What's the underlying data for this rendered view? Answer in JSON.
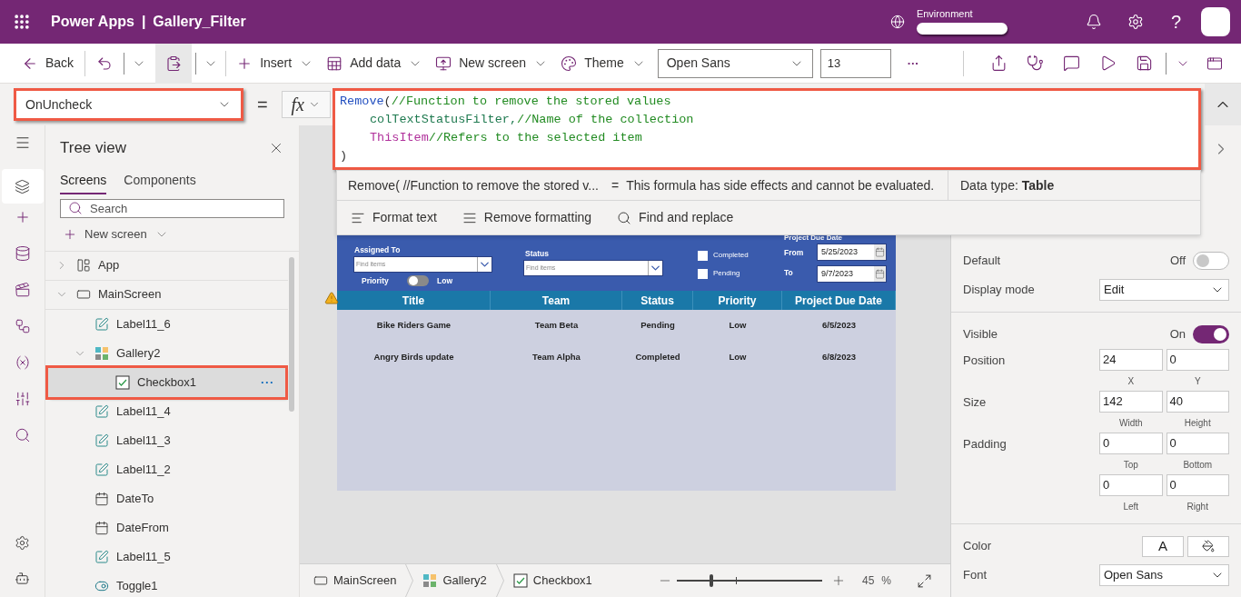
{
  "app_bar": {
    "product": "Power Apps",
    "separator": "|",
    "app_name": "Gallery_Filter",
    "environment_label": "Environment",
    "help_glyph": "?"
  },
  "toolbar": {
    "back": "Back",
    "paste_active": true,
    "commands": [
      {
        "label": "Insert",
        "kind": "insert"
      },
      {
        "label": "Add data",
        "kind": "add_data"
      },
      {
        "label": "New screen",
        "kind": "new_screen"
      },
      {
        "label": "Theme",
        "kind": "theme"
      }
    ],
    "font": "Open Sans",
    "font_size": "13",
    "more": "···"
  },
  "formula_bar": {
    "property": "OnUncheck",
    "property_highlighted": true,
    "equals": "=",
    "fx": "fx",
    "editor_highlighted": true,
    "code_lines": [
      {
        "indented": false,
        "tokens": [
          {
            "kind": "function",
            "text": "Remove"
          },
          {
            "kind": "punctuation",
            "text": "("
          },
          {
            "kind": "comment",
            "text": "//Function to remove the stored values"
          }
        ]
      },
      {
        "indented": true,
        "tokens": [
          {
            "kind": "collection",
            "text": "colTextStatusFilter,"
          },
          {
            "kind": "comment",
            "text": "//Name of the collection"
          }
        ]
      },
      {
        "indented": true,
        "tokens": [
          {
            "kind": "keyword",
            "text": "ThisItem"
          },
          {
            "kind": "comment",
            "text": "//Refers to the selected item"
          }
        ]
      },
      {
        "indented": false,
        "tokens": [
          {
            "kind": "punctuation",
            "text": ")"
          }
        ]
      }
    ],
    "result": {
      "expression": "Remove( //Function to remove the stored v...",
      "equals": "=",
      "message": "This formula has side effects and cannot be evaluated.",
      "data_type_label": "Data type:",
      "data_type": "Table"
    },
    "actions": [
      {
        "label": "Format text",
        "kind": "format"
      },
      {
        "label": "Remove formatting",
        "kind": "clear"
      },
      {
        "label": "Find and replace",
        "kind": "find"
      }
    ]
  },
  "tree_view": {
    "title": "Tree view",
    "tabs": [
      {
        "label": "Screens",
        "selected": true
      },
      {
        "label": "Components",
        "selected": false
      }
    ],
    "search_placeholder": "Search",
    "new_screen": "New screen",
    "items": [
      {
        "name": "App",
        "kind": "app",
        "expanded": false,
        "selected": false,
        "highlighted": false
      },
      {
        "name": "MainScreen",
        "kind": "screen",
        "expanded": true,
        "selected": false,
        "highlighted": false,
        "children": [
          {
            "name": "Label11_6",
            "kind": "label",
            "selected": false,
            "highlighted": false
          },
          {
            "name": "Gallery2",
            "kind": "gallery",
            "expanded": true,
            "selected": false,
            "highlighted": false,
            "children": [
              {
                "name": "Checkbox1",
                "kind": "checkbox",
                "selected": true,
                "highlighted": true,
                "more": "···"
              }
            ]
          },
          {
            "name": "Label11_4",
            "kind": "label",
            "selected": false,
            "highlighted": false
          },
          {
            "name": "Label11_3",
            "kind": "label",
            "selected": false,
            "highlighted": false
          },
          {
            "name": "Label11_2",
            "kind": "label",
            "selected": false,
            "highlighted": false
          },
          {
            "name": "DateTo",
            "kind": "date",
            "selected": false,
            "highlighted": false
          },
          {
            "name": "DateFrom",
            "kind": "date",
            "selected": false,
            "highlighted": false
          },
          {
            "name": "Label11_5",
            "kind": "label",
            "selected": false,
            "highlighted": false
          },
          {
            "name": "Toggle1",
            "kind": "toggle",
            "selected": false,
            "highlighted": false
          }
        ]
      }
    ]
  },
  "canvas": {
    "filters": {
      "assigned_to": {
        "label": "Assigned To",
        "placeholder": "Find items"
      },
      "priority": {
        "label": "Priority",
        "on": false,
        "value_label": "Low"
      },
      "status": {
        "label": "Status",
        "placeholder": "Find items"
      },
      "checkboxes": [
        {
          "label": "Completed",
          "checked": false
        },
        {
          "label": "Pending",
          "checked": false
        }
      ],
      "due_date": {
        "title": "Project Due Date",
        "from_label": "From",
        "from": "5/25/2023",
        "to_label": "To",
        "to": "9/7/2023"
      }
    },
    "table": {
      "columns": [
        "Title",
        "Team",
        "Status",
        "Priority",
        "Project Due Date"
      ],
      "rows": [
        [
          "Bike Riders Game",
          "Team Beta",
          "Pending",
          "Low",
          "6/5/2023"
        ],
        [
          "Angry Birds update",
          "Team Alpha",
          "Completed",
          "Low",
          "6/8/2023"
        ]
      ]
    }
  },
  "breadcrumb": [
    {
      "label": "MainScreen",
      "kind": "screen"
    },
    {
      "label": "Gallery2",
      "kind": "gallery"
    },
    {
      "label": "Checkbox1",
      "kind": "checkbox"
    }
  ],
  "zoom": {
    "level": 0.24,
    "value": "45",
    "unit": "%"
  },
  "properties": {
    "sections": [
      {
        "rows": [
          {
            "kind": "toggle",
            "label": "Default",
            "state_text": "Off",
            "on": false
          },
          {
            "kind": "dropdown",
            "label": "Display mode",
            "value": "Edit"
          }
        ]
      },
      {
        "rows": [
          {
            "kind": "toggle",
            "label": "Visible",
            "state_text": "On",
            "on": true
          },
          {
            "kind": "fields",
            "label": "Position",
            "fields": [
              {
                "value": "24",
                "caption": "X"
              },
              {
                "value": "0",
                "caption": "Y"
              }
            ]
          },
          {
            "kind": "fields",
            "label": "Size",
            "fields": [
              {
                "value": "142",
                "caption": "Width"
              },
              {
                "value": "40",
                "caption": "Height"
              }
            ]
          },
          {
            "kind": "fields",
            "label": "Padding",
            "fields": [
              {
                "value": "0",
                "caption": "Top"
              },
              {
                "value": "0",
                "caption": "Bottom"
              },
              {
                "value": "0",
                "caption": "Left"
              },
              {
                "value": "0",
                "caption": "Right"
              }
            ]
          }
        ]
      },
      {
        "rows": [
          {
            "kind": "color",
            "label": "Color",
            "glyph": "A"
          },
          {
            "kind": "dropdown",
            "label": "Font",
            "value": "Open Sans"
          }
        ]
      }
    ]
  }
}
